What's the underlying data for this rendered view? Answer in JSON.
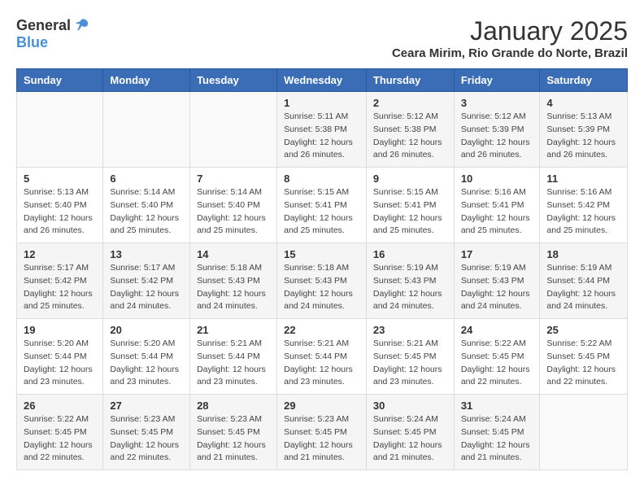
{
  "logo": {
    "general": "General",
    "blue": "Blue"
  },
  "title": "January 2025",
  "subtitle": "Ceara Mirim, Rio Grande do Norte, Brazil",
  "weekdays": [
    "Sunday",
    "Monday",
    "Tuesday",
    "Wednesday",
    "Thursday",
    "Friday",
    "Saturday"
  ],
  "weeks": [
    [
      {
        "day": "",
        "sunrise": "",
        "sunset": "",
        "daylight": ""
      },
      {
        "day": "",
        "sunrise": "",
        "sunset": "",
        "daylight": ""
      },
      {
        "day": "",
        "sunrise": "",
        "sunset": "",
        "daylight": ""
      },
      {
        "day": "1",
        "sunrise": "Sunrise: 5:11 AM",
        "sunset": "Sunset: 5:38 PM",
        "daylight": "Daylight: 12 hours and 26 minutes."
      },
      {
        "day": "2",
        "sunrise": "Sunrise: 5:12 AM",
        "sunset": "Sunset: 5:38 PM",
        "daylight": "Daylight: 12 hours and 26 minutes."
      },
      {
        "day": "3",
        "sunrise": "Sunrise: 5:12 AM",
        "sunset": "Sunset: 5:39 PM",
        "daylight": "Daylight: 12 hours and 26 minutes."
      },
      {
        "day": "4",
        "sunrise": "Sunrise: 5:13 AM",
        "sunset": "Sunset: 5:39 PM",
        "daylight": "Daylight: 12 hours and 26 minutes."
      }
    ],
    [
      {
        "day": "5",
        "sunrise": "Sunrise: 5:13 AM",
        "sunset": "Sunset: 5:40 PM",
        "daylight": "Daylight: 12 hours and 26 minutes."
      },
      {
        "day": "6",
        "sunrise": "Sunrise: 5:14 AM",
        "sunset": "Sunset: 5:40 PM",
        "daylight": "Daylight: 12 hours and 25 minutes."
      },
      {
        "day": "7",
        "sunrise": "Sunrise: 5:14 AM",
        "sunset": "Sunset: 5:40 PM",
        "daylight": "Daylight: 12 hours and 25 minutes."
      },
      {
        "day": "8",
        "sunrise": "Sunrise: 5:15 AM",
        "sunset": "Sunset: 5:41 PM",
        "daylight": "Daylight: 12 hours and 25 minutes."
      },
      {
        "day": "9",
        "sunrise": "Sunrise: 5:15 AM",
        "sunset": "Sunset: 5:41 PM",
        "daylight": "Daylight: 12 hours and 25 minutes."
      },
      {
        "day": "10",
        "sunrise": "Sunrise: 5:16 AM",
        "sunset": "Sunset: 5:41 PM",
        "daylight": "Daylight: 12 hours and 25 minutes."
      },
      {
        "day": "11",
        "sunrise": "Sunrise: 5:16 AM",
        "sunset": "Sunset: 5:42 PM",
        "daylight": "Daylight: 12 hours and 25 minutes."
      }
    ],
    [
      {
        "day": "12",
        "sunrise": "Sunrise: 5:17 AM",
        "sunset": "Sunset: 5:42 PM",
        "daylight": "Daylight: 12 hours and 25 minutes."
      },
      {
        "day": "13",
        "sunrise": "Sunrise: 5:17 AM",
        "sunset": "Sunset: 5:42 PM",
        "daylight": "Daylight: 12 hours and 24 minutes."
      },
      {
        "day": "14",
        "sunrise": "Sunrise: 5:18 AM",
        "sunset": "Sunset: 5:43 PM",
        "daylight": "Daylight: 12 hours and 24 minutes."
      },
      {
        "day": "15",
        "sunrise": "Sunrise: 5:18 AM",
        "sunset": "Sunset: 5:43 PM",
        "daylight": "Daylight: 12 hours and 24 minutes."
      },
      {
        "day": "16",
        "sunrise": "Sunrise: 5:19 AM",
        "sunset": "Sunset: 5:43 PM",
        "daylight": "Daylight: 12 hours and 24 minutes."
      },
      {
        "day": "17",
        "sunrise": "Sunrise: 5:19 AM",
        "sunset": "Sunset: 5:43 PM",
        "daylight": "Daylight: 12 hours and 24 minutes."
      },
      {
        "day": "18",
        "sunrise": "Sunrise: 5:19 AM",
        "sunset": "Sunset: 5:44 PM",
        "daylight": "Daylight: 12 hours and 24 minutes."
      }
    ],
    [
      {
        "day": "19",
        "sunrise": "Sunrise: 5:20 AM",
        "sunset": "Sunset: 5:44 PM",
        "daylight": "Daylight: 12 hours and 23 minutes."
      },
      {
        "day": "20",
        "sunrise": "Sunrise: 5:20 AM",
        "sunset": "Sunset: 5:44 PM",
        "daylight": "Daylight: 12 hours and 23 minutes."
      },
      {
        "day": "21",
        "sunrise": "Sunrise: 5:21 AM",
        "sunset": "Sunset: 5:44 PM",
        "daylight": "Daylight: 12 hours and 23 minutes."
      },
      {
        "day": "22",
        "sunrise": "Sunrise: 5:21 AM",
        "sunset": "Sunset: 5:44 PM",
        "daylight": "Daylight: 12 hours and 23 minutes."
      },
      {
        "day": "23",
        "sunrise": "Sunrise: 5:21 AM",
        "sunset": "Sunset: 5:45 PM",
        "daylight": "Daylight: 12 hours and 23 minutes."
      },
      {
        "day": "24",
        "sunrise": "Sunrise: 5:22 AM",
        "sunset": "Sunset: 5:45 PM",
        "daylight": "Daylight: 12 hours and 22 minutes."
      },
      {
        "day": "25",
        "sunrise": "Sunrise: 5:22 AM",
        "sunset": "Sunset: 5:45 PM",
        "daylight": "Daylight: 12 hours and 22 minutes."
      }
    ],
    [
      {
        "day": "26",
        "sunrise": "Sunrise: 5:22 AM",
        "sunset": "Sunset: 5:45 PM",
        "daylight": "Daylight: 12 hours and 22 minutes."
      },
      {
        "day": "27",
        "sunrise": "Sunrise: 5:23 AM",
        "sunset": "Sunset: 5:45 PM",
        "daylight": "Daylight: 12 hours and 22 minutes."
      },
      {
        "day": "28",
        "sunrise": "Sunrise: 5:23 AM",
        "sunset": "Sunset: 5:45 PM",
        "daylight": "Daylight: 12 hours and 21 minutes."
      },
      {
        "day": "29",
        "sunrise": "Sunrise: 5:23 AM",
        "sunset": "Sunset: 5:45 PM",
        "daylight": "Daylight: 12 hours and 21 minutes."
      },
      {
        "day": "30",
        "sunrise": "Sunrise: 5:24 AM",
        "sunset": "Sunset: 5:45 PM",
        "daylight": "Daylight: 12 hours and 21 minutes."
      },
      {
        "day": "31",
        "sunrise": "Sunrise: 5:24 AM",
        "sunset": "Sunset: 5:45 PM",
        "daylight": "Daylight: 12 hours and 21 minutes."
      },
      {
        "day": "",
        "sunrise": "",
        "sunset": "",
        "daylight": ""
      }
    ]
  ]
}
